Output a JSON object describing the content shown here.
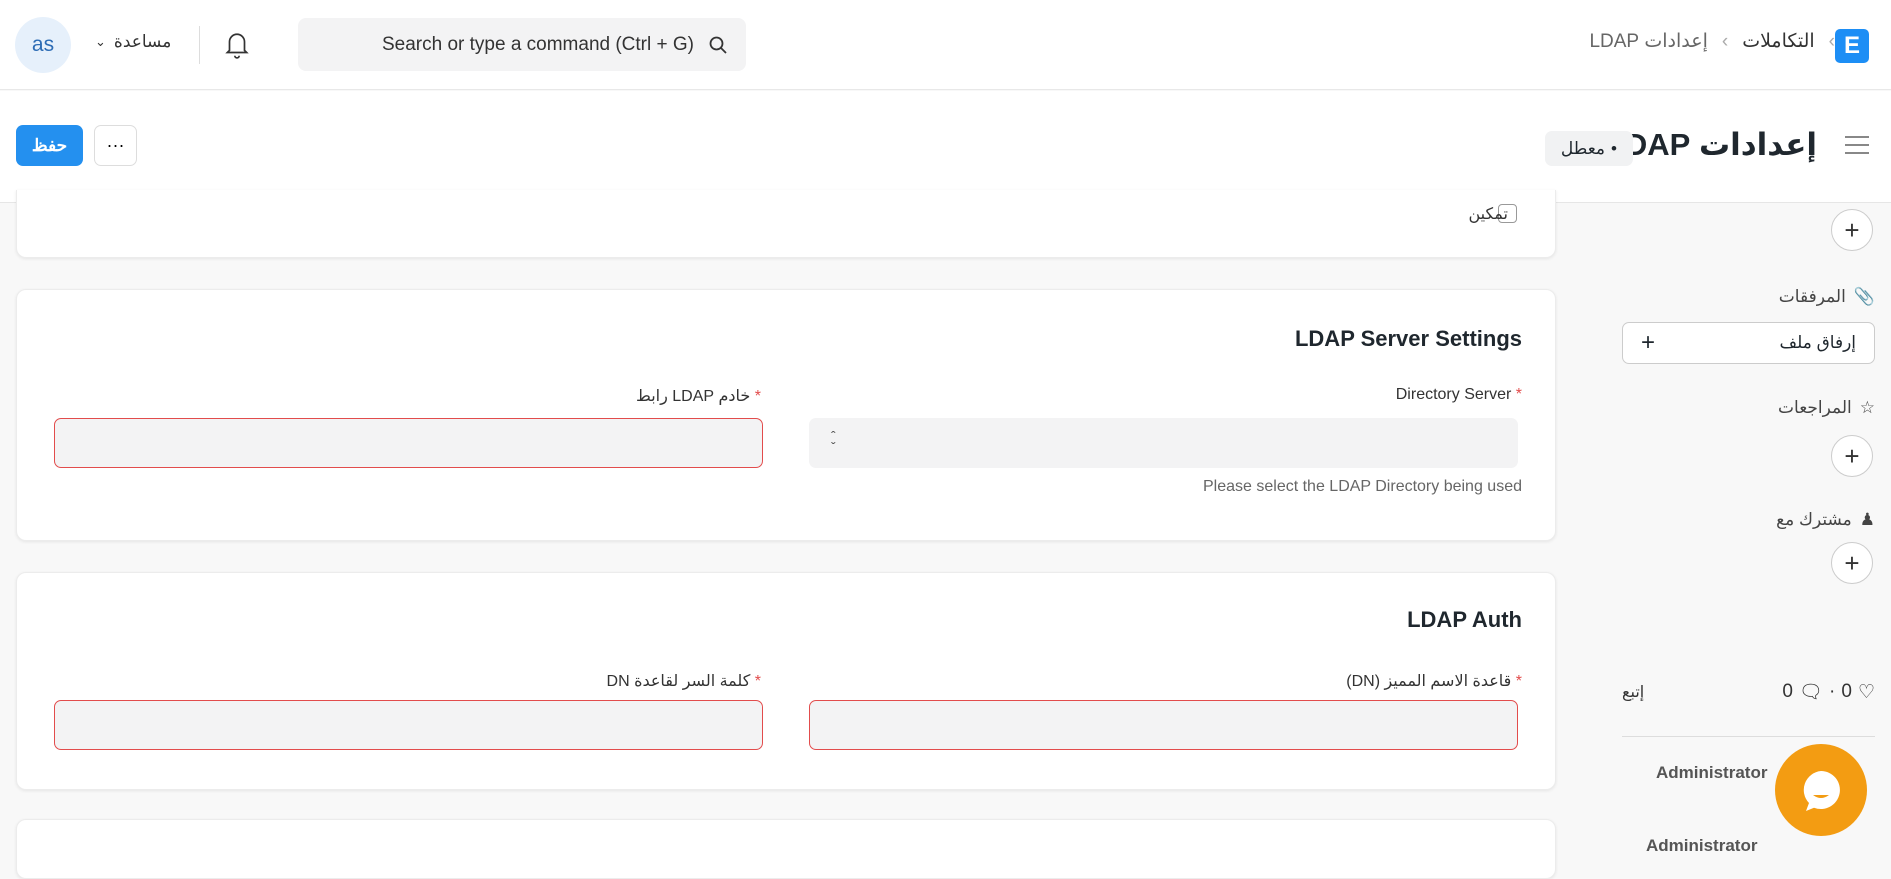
{
  "navbar": {
    "avatar": "as",
    "help": "مساعدة",
    "search_placeholder": "Search or type a command (Ctrl + G)",
    "breadcrumbs": [
      "التكاملات",
      "إعدادات LDAP"
    ],
    "logo": "E"
  },
  "page": {
    "title": "إعدادات LDAP",
    "status": "معطل",
    "save": "حفظ",
    "more": "···"
  },
  "enable_card": {
    "checkbox_label": "تمكين"
  },
  "server_card": {
    "title": "LDAP Server Settings",
    "directory_label": "Directory Server",
    "directory_help": "Please select the LDAP Directory being used",
    "url_label": "خادم LDAP رابط"
  },
  "auth_card": {
    "title": "LDAP Auth",
    "dn_label": "قاعدة الاسم المميز (DN)",
    "password_label": "كلمة السر لقاعدة DN"
  },
  "sidebar": {
    "attachments": "المرفقات",
    "attach_file": "إرفاق ملف",
    "reviews": "المراجعات",
    "shared_with": "مشترك مع",
    "likes": "0",
    "comments": "0",
    "follow": "إتبع",
    "activity_user": "Administrator",
    "activity_user2": "Administrator"
  },
  "colors": {
    "primary": "#2490ef",
    "required": "#e24c4c",
    "chat": "#f39c12"
  }
}
